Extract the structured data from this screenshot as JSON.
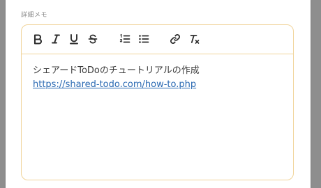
{
  "form": {
    "memo_label": "詳細メモ"
  },
  "toolbar": {
    "items": [
      {
        "name": "bold",
        "icon": "bold-icon"
      },
      {
        "name": "italic",
        "icon": "italic-icon"
      },
      {
        "name": "underline",
        "icon": "underline-icon"
      },
      {
        "name": "strikethrough",
        "icon": "strikethrough-icon"
      },
      {
        "name": "ordered-list",
        "icon": "ordered-list-icon"
      },
      {
        "name": "bullet-list",
        "icon": "bullet-list-icon"
      },
      {
        "name": "link",
        "icon": "link-icon"
      },
      {
        "name": "clear-format",
        "icon": "clear-format-icon"
      }
    ]
  },
  "editor": {
    "line1": "シェアードToDoのチュートリアルの作成",
    "link_text": "https://shared-todo.com/how-to.php"
  },
  "colors": {
    "label": "#8a8a8a",
    "border": "#f1d49a",
    "link": "#2b6ab3",
    "text": "#3d3d3d",
    "backdrop": "#8e8e8e"
  }
}
